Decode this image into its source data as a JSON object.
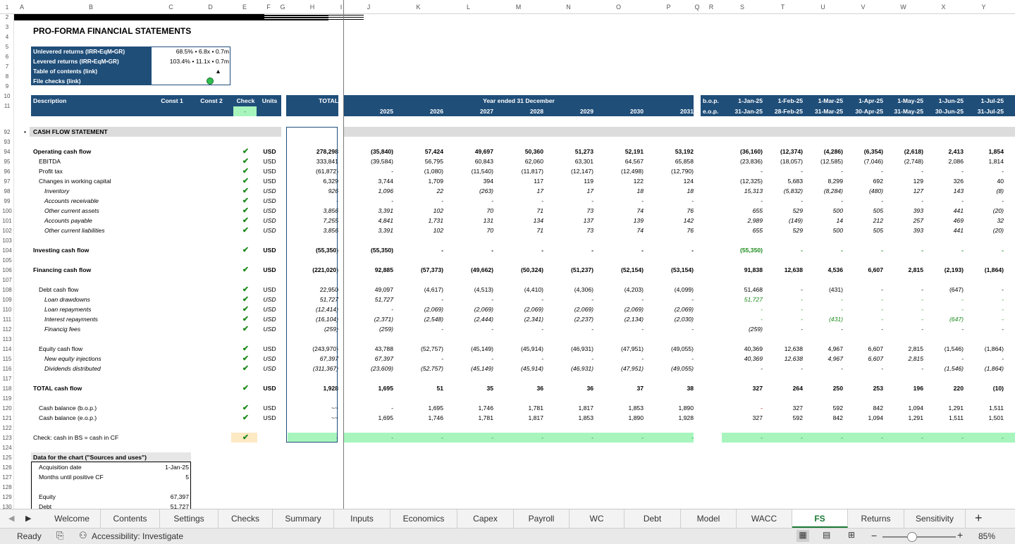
{
  "col_headers": [
    "A",
    "B",
    "C",
    "D",
    "E",
    "F",
    "G",
    "H",
    "I",
    "J",
    "K",
    "L",
    "M",
    "N",
    "O",
    "P",
    "Q",
    "R",
    "S",
    "T",
    "U",
    "V",
    "W",
    "X",
    "Y"
  ],
  "title": "PRO-FORMA FINANCIAL STATEMENTS",
  "infobox": [
    {
      "label": "Unlevered returns (IRR•EqM•GR)",
      "value": "68.5% • 6.8x • 0.7m"
    },
    {
      "label": "Levered returns (IRR•EqM•GR)",
      "value": "103.4% • 11.1x • 0.7m"
    },
    {
      "label": "Table of contents (link)",
      "value": "▲"
    },
    {
      "label": "File checks (link)",
      "value": ""
    }
  ],
  "header": {
    "description": "Description",
    "const1": "Const 1",
    "const2": "Const 2",
    "check": "Check",
    "check_value": "-",
    "units": "Units",
    "total": "TOTAL",
    "year_ended": "Year ended 31 December",
    "years": [
      "2025",
      "2026",
      "2027",
      "2028",
      "2029",
      "2030",
      "2031"
    ],
    "bop": "b.o.p.",
    "eop": "e.o.p.",
    "month_start": [
      "1-Jan-25",
      "1-Feb-25",
      "1-Mar-25",
      "1-Apr-25",
      "1-May-25",
      "1-Jun-25",
      "1-Jul-25"
    ],
    "month_end": [
      "31-Jan-25",
      "28-Feb-25",
      "31-Mar-25",
      "30-Apr-25",
      "31-May-25",
      "30-Jun-25",
      "31-Jul-25"
    ]
  },
  "section_title": "CASH FLOW STATEMENT",
  "rows": [
    {
      "n": 94,
      "label": "Operating cash flow",
      "lvl": 0,
      "style": "b",
      "tick": true,
      "units": "USD",
      "total": "278,298",
      "years": [
        "(35,840)",
        "57,424",
        "49,697",
        "50,360",
        "51,273",
        "52,191",
        "53,192"
      ],
      "months": [
        "(36,160)",
        "(12,374)",
        "(4,286)",
        "(6,354)",
        "(2,618)",
        "2,413",
        "1,854"
      ]
    },
    {
      "n": 95,
      "label": "EBITDA",
      "lvl": 1,
      "style": "",
      "tick": true,
      "units": "USD",
      "total": "333,841",
      "years": [
        "(39,584)",
        "56,795",
        "60,843",
        "62,060",
        "63,301",
        "64,567",
        "65,858"
      ],
      "months": [
        "(23,836)",
        "(18,057)",
        "(12,585)",
        "(7,046)",
        "(2,748)",
        "2,086",
        "1,814"
      ]
    },
    {
      "n": 96,
      "label": "Profit tax",
      "lvl": 1,
      "style": "",
      "tick": true,
      "units": "USD",
      "total": "(61,872)",
      "years": [
        "-",
        "(1,080)",
        "(11,540)",
        "(11,817)",
        "(12,147)",
        "(12,498)",
        "(12,790)"
      ],
      "months": [
        "-",
        "-",
        "-",
        "-",
        "-",
        "-",
        "-"
      ]
    },
    {
      "n": 97,
      "label": "Changes in working capital",
      "lvl": 1,
      "style": "",
      "tick": true,
      "units": "USD",
      "total": "6,329",
      "years": [
        "3,744",
        "1,709",
        "394",
        "117",
        "119",
        "122",
        "124"
      ],
      "months": [
        "(12,325)",
        "5,683",
        "8,299",
        "692",
        "129",
        "326",
        "40"
      ]
    },
    {
      "n": 98,
      "label": "Inventory",
      "lvl": 2,
      "style": "i",
      "tick": true,
      "units": "USD",
      "total": "926",
      "years": [
        "1,096",
        "22",
        "(263)",
        "17",
        "17",
        "18",
        "18"
      ],
      "months": [
        "15,313",
        "(5,832)",
        "(8,284)",
        "(480)",
        "127",
        "143",
        "(8)"
      ]
    },
    {
      "n": 99,
      "label": "Accounts receivable",
      "lvl": 2,
      "style": "i",
      "tick": true,
      "units": "USD",
      "total": "-",
      "years": [
        "-",
        "-",
        "-",
        "-",
        "-",
        "-",
        "-"
      ],
      "months": [
        "-",
        "-",
        "-",
        "-",
        "-",
        "-",
        "-"
      ]
    },
    {
      "n": 100,
      "label": "Other current assets",
      "lvl": 2,
      "style": "i",
      "tick": true,
      "units": "USD",
      "total": "3,856",
      "years": [
        "3,391",
        "102",
        "70",
        "71",
        "73",
        "74",
        "76"
      ],
      "months": [
        "655",
        "529",
        "500",
        "505",
        "393",
        "441",
        "(20)"
      ]
    },
    {
      "n": 101,
      "label": "Accounts payable",
      "lvl": 2,
      "style": "i",
      "tick": true,
      "units": "USD",
      "total": "7,255",
      "years": [
        "4,841",
        "1,731",
        "131",
        "134",
        "137",
        "139",
        "142"
      ],
      "months": [
        "2,989",
        "(149)",
        "14",
        "212",
        "257",
        "469",
        "32"
      ]
    },
    {
      "n": 102,
      "label": "Other current liabilities",
      "lvl": 2,
      "style": "i",
      "tick": true,
      "units": "USD",
      "total": "3,856",
      "years": [
        "3,391",
        "102",
        "70",
        "71",
        "73",
        "74",
        "76"
      ],
      "months": [
        "655",
        "529",
        "500",
        "505",
        "393",
        "441",
        "(20)"
      ]
    },
    {
      "n": 104,
      "label": "Investing cash flow",
      "lvl": 0,
      "style": "b",
      "tick": true,
      "units": "USD",
      "total": "(55,350)",
      "years": [
        "(55,350)",
        "-",
        "-",
        "-",
        "-",
        "-",
        "-"
      ],
      "months": [
        "(55,350)",
        "-",
        "-",
        "-",
        "-",
        "-",
        "-"
      ],
      "mgreen": true
    },
    {
      "n": 106,
      "label": "Financing cash flow",
      "lvl": 0,
      "style": "b",
      "tick": true,
      "units": "USD",
      "total": "(221,020)",
      "years": [
        "92,885",
        "(57,373)",
        "(49,662)",
        "(50,324)",
        "(51,237)",
        "(52,154)",
        "(53,154)"
      ],
      "months": [
        "91,838",
        "12,638",
        "4,536",
        "6,607",
        "2,815",
        "(2,193)",
        "(1,864)"
      ]
    },
    {
      "n": 108,
      "label": "Debt cash flow",
      "lvl": 1,
      "style": "",
      "tick": true,
      "units": "USD",
      "total": "22,950",
      "years": [
        "49,097",
        "(4,617)",
        "(4,513)",
        "(4,410)",
        "(4,306)",
        "(4,203)",
        "(4,099)"
      ],
      "months": [
        "51,468",
        "-",
        "(431)",
        "-",
        "-",
        "(647)",
        "-"
      ]
    },
    {
      "n": 109,
      "label": "Loan drawdowns",
      "lvl": 2,
      "style": "i",
      "tick": true,
      "units": "USD",
      "total": "51,727",
      "years": [
        "51,727",
        "-",
        "-",
        "-",
        "-",
        "-",
        "-"
      ],
      "months": [
        "51,727",
        "-",
        "-",
        "-",
        "-",
        "-",
        "-"
      ],
      "mgreen": true
    },
    {
      "n": 110,
      "label": "Loan repayments",
      "lvl": 2,
      "style": "i",
      "tick": true,
      "units": "USD",
      "total": "(12,414)",
      "years": [
        "-",
        "(2,069)",
        "(2,069)",
        "(2,069)",
        "(2,069)",
        "(2,069)",
        "(2,069)"
      ],
      "months": [
        "-",
        "-",
        "-",
        "-",
        "-",
        "-",
        "-"
      ],
      "mgreen": true
    },
    {
      "n": 111,
      "label": "Interest repayments",
      "lvl": 2,
      "style": "i",
      "tick": true,
      "units": "USD",
      "total": "(16,104)",
      "years": [
        "(2,371)",
        "(2,548)",
        "(2,444)",
        "(2,341)",
        "(2,237)",
        "(2,134)",
        "(2,030)"
      ],
      "months": [
        "-",
        "-",
        "(431)",
        "-",
        "-",
        "(647)",
        "-"
      ],
      "mgreen": true
    },
    {
      "n": 112,
      "label": "Financig fees",
      "lvl": 2,
      "style": "i",
      "tick": true,
      "units": "USD",
      "total": "(259)",
      "years": [
        "(259)",
        "-",
        "-",
        "-",
        "-",
        "-",
        "-"
      ],
      "months": [
        "(259)",
        "-",
        "-",
        "-",
        "-",
        "-",
        "-"
      ]
    },
    {
      "n": 114,
      "label": "Equity cash flow",
      "lvl": 1,
      "style": "",
      "tick": true,
      "units": "USD",
      "total": "(243,970)",
      "years": [
        "43,788",
        "(52,757)",
        "(45,149)",
        "(45,914)",
        "(46,931)",
        "(47,951)",
        "(49,055)"
      ],
      "months": [
        "40,369",
        "12,638",
        "4,967",
        "6,607",
        "2,815",
        "(1,546)",
        "(1,864)"
      ]
    },
    {
      "n": 115,
      "label": "New equity injections",
      "lvl": 2,
      "style": "i",
      "tick": true,
      "units": "USD",
      "total": "67,397",
      "years": [
        "67,397",
        "-",
        "-",
        "-",
        "-",
        "-",
        "-"
      ],
      "months": [
        "40,369",
        "12,638",
        "4,967",
        "6,607",
        "2,815",
        "-",
        "-"
      ]
    },
    {
      "n": 116,
      "label": "Dividends distributed",
      "lvl": 2,
      "style": "i",
      "tick": true,
      "units": "USD",
      "total": "(311,367)",
      "years": [
        "(23,609)",
        "(52,757)",
        "(45,149)",
        "(45,914)",
        "(46,931)",
        "(47,951)",
        "(49,055)"
      ],
      "months": [
        "-",
        "-",
        "-",
        "-",
        "-",
        "(1,546)",
        "(1,864)"
      ]
    },
    {
      "n": 118,
      "label": "TOTAL cash flow",
      "lvl": 0,
      "style": "b",
      "tick": true,
      "units": "USD",
      "total": "1,928",
      "years": [
        "1,695",
        "51",
        "35",
        "36",
        "36",
        "37",
        "38"
      ],
      "months": [
        "327",
        "264",
        "250",
        "253",
        "196",
        "220",
        "(10)"
      ]
    },
    {
      "n": 120,
      "label": "Cash balance (b.o.p.)",
      "lvl": 1,
      "style": "",
      "tick": true,
      "units": "USD",
      "total": "~~",
      "years": [
        "-",
        "1,695",
        "1,746",
        "1,781",
        "1,817",
        "1,853",
        "1,890"
      ],
      "months": [
        "-",
        "327",
        "592",
        "842",
        "1,094",
        "1,291",
        "1,511"
      ]
    },
    {
      "n": 121,
      "label": "Cash balance (e.o.p.)",
      "lvl": 1,
      "style": "",
      "tick": true,
      "units": "USD",
      "total": "~~",
      "years": [
        "1,695",
        "1,746",
        "1,781",
        "1,817",
        "1,853",
        "1,890",
        "1,928"
      ],
      "months": [
        "327",
        "592",
        "842",
        "1,094",
        "1,291",
        "1,511",
        "1,501"
      ]
    }
  ],
  "check_row": {
    "label": "Check: cash in BS = cash in CF",
    "total": "-",
    "years": [
      "-",
      "-",
      "-",
      "-",
      "-",
      "-",
      "-"
    ],
    "months": [
      "-",
      "-",
      "-",
      "-",
      "-",
      "-",
      "-"
    ]
  },
  "chart_box": {
    "title": "Data for the chart (\"Sources and uses\")",
    "rows": [
      {
        "label": "Acquisition date",
        "value": "1-Jan-25"
      },
      {
        "label": "Months until positive CF",
        "value": "5"
      },
      {
        "label": "",
        "value": ""
      },
      {
        "label": "Equity",
        "value": "67,397"
      },
      {
        "label": "Debt",
        "value": "51,727"
      }
    ]
  },
  "tick_symbol": "✔",
  "tabs": [
    "Welcome",
    "Contents",
    "Settings",
    "Checks",
    "Summary",
    "Inputs",
    "Economics",
    "Capex",
    "Payroll",
    "WC",
    "Debt",
    "Model",
    "WACC",
    "FS",
    "Returns",
    "Sensitivity"
  ],
  "active_tab": "FS",
  "status": {
    "ready": "Ready",
    "accessibility": "Accessibility: Investigate",
    "zoom": "85%"
  }
}
